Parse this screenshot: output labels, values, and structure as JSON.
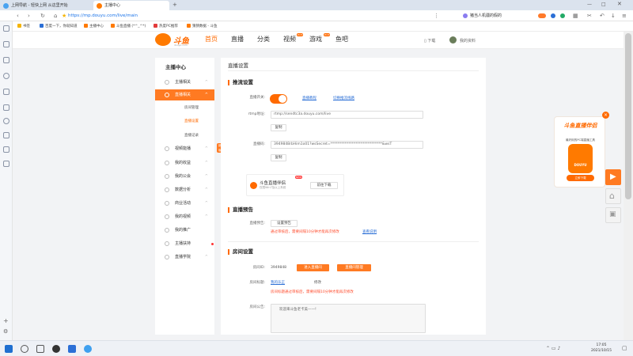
{
  "browser": {
    "tabs": [
      {
        "label": "上网导航 - 轻快上网 从这里开始"
      },
      {
        "label": "主播中心"
      }
    ],
    "url": "https://mp.douyu.com/live/main",
    "address_right_text": "猪当人机疆的假的",
    "bookmarks": [
      "书签",
      "百度一下，你就知道",
      "主播中心",
      "斗鱼直播 (*^_^*)",
      "热度PC推荐",
      "猜猜数据 - 斗鱼"
    ]
  },
  "site": {
    "logo_text": "斗鱼",
    "logo_sub": "douyu.com",
    "nav": [
      "首页",
      "直播",
      "分类",
      "视频",
      "游戏",
      "鱼吧"
    ],
    "nav_badge": "HOT",
    "download": "下载",
    "user": "我的资料"
  },
  "sidebar": {
    "title": "主播中心",
    "items": [
      {
        "label": "主播相关",
        "chevron": "^"
      },
      {
        "label": "直播相关",
        "chevron": "^"
      },
      {
        "label": "视频能播",
        "chevron": "^"
      },
      {
        "label": "我的收益",
        "chevron": "^"
      },
      {
        "label": "我的公会",
        "chevron": "^"
      },
      {
        "label": "数据分析",
        "chevron": "^"
      },
      {
        "label": "商业活动",
        "chevron": "^"
      },
      {
        "label": "我的视频",
        "chevron": "^"
      },
      {
        "label": "我的推广",
        "chevron": ""
      },
      {
        "label": "主播扶持",
        "chevron": ""
      },
      {
        "label": "直播学院",
        "chevron": "^"
      }
    ],
    "sub_items": [
      "房间管理",
      "直播设置",
      "直播记录"
    ],
    "new_badge": "新版"
  },
  "main": {
    "title": "直播设置",
    "push": {
      "heading": "推流设置",
      "switch_label": "直播开关:",
      "tutorial_link": "直播教程",
      "alt_link": "切换推流线路",
      "rtmp_label": "rtmp地址:",
      "rtmp_value": "rtmp://sendtc3a.douyu.com/live",
      "copy1": "复制",
      "code_label": "直播码:",
      "code_value": "3949848rbHim1o01?wsSecret=*****************************&wsT",
      "copy2": "复制"
    },
    "banner": {
      "title": "斗鱼直播伴侣",
      "sub": "仅限Win7及以上系统",
      "badge": "NEW",
      "button": "前往下载"
    },
    "preview": {
      "heading": "直播预告",
      "label": "直播预告:",
      "button": "设置预告",
      "note": "通过审核后，需要间隔10分钟才能再次修改",
      "link": "查看说明"
    },
    "room": {
      "heading": "房间设置",
      "id_label": "房间ID:",
      "id_value": "3949848",
      "enter_button": "进入直播间",
      "manage_button": "直播间管理",
      "title_label": "房间标题:",
      "title_value": "我的乐正",
      "edit": "修改",
      "title_note": "房间标题通过审核后，需要间隔10分钟才能再次修改",
      "notice_label": "房间公告:",
      "notice_value": "欢迎来斗鱼老卡美——!"
    }
  },
  "promo": {
    "title": "斗鱼直播伴侣",
    "sub": "最好用的PC端直播工具",
    "img_text": "DOUYU",
    "button": "立即下载",
    "close": "×"
  },
  "taskbar": {
    "time": "17:05",
    "date": "2021/10/15"
  }
}
